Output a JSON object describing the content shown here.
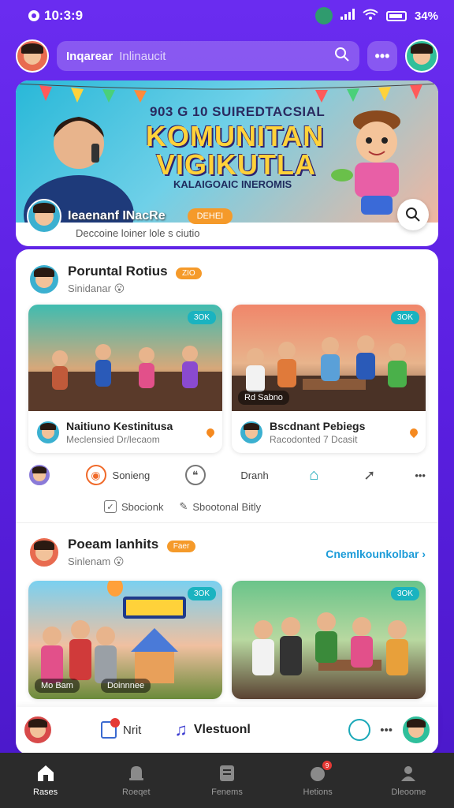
{
  "status": {
    "time": "10:3:9",
    "battery": "34%"
  },
  "top": {
    "search_label": "Inqarear",
    "search_placeholder": "Inlinaucit",
    "more": "•••"
  },
  "hero": {
    "line1": "903 G 10 SUIREDTACSIAL",
    "line2": "KOMUNITAN",
    "line3": "VIGIKUTLA",
    "subtitle": "KALAIGOAIC INEROMIS",
    "name": "Ieaenanf INacRe",
    "tag": "DEHEI",
    "caption": "Deccoine loiner lole s ciutio"
  },
  "post1": {
    "title": "Poruntal Rotius",
    "badge": "ZIO",
    "sub": "Sinidanar",
    "tiles": [
      {
        "tag": "3OK",
        "label": "",
        "name": "Naitiuno Kestinitusa",
        "meta": "Meclensied Dr/lecaom"
      },
      {
        "tag": "3OK",
        "label": "Rd  Sabno",
        "name": "Bscdnant Pebiegs",
        "meta": "Racodonted 7 Dcasit"
      }
    ]
  },
  "actions": [
    {
      "icon": "avatar",
      "label": ""
    },
    {
      "icon": "chat-icon",
      "label": "Sonieng"
    },
    {
      "icon": "quote-icon",
      "label": "Dranh"
    },
    {
      "icon": "screen-icon",
      "label": ""
    },
    {
      "icon": "share-icon",
      "label": ""
    },
    {
      "icon": "more-icon",
      "label": "•••"
    }
  ],
  "subactions": [
    "Sbocionk",
    "Sbootonal Bitly"
  ],
  "post2": {
    "title": "Poeam lanhits",
    "badge": "Faer",
    "sub": "Sinlenam",
    "link": "Cnemlkounkolbar  ›",
    "tiles": [
      {
        "tag": "3OK",
        "label": "Mo Bam",
        "sub_label": "Doinnnee"
      },
      {
        "tag": "3OK",
        "label": ""
      }
    ]
  },
  "mini_bar": {
    "item1": "Nrit",
    "item2": "Vlestuonl",
    "more": "•••"
  },
  "nav": [
    {
      "label": "Rases",
      "icon": "home-icon",
      "active": true
    },
    {
      "label": "Roeqet",
      "icon": "bell-icon",
      "active": false
    },
    {
      "label": "Fenems",
      "icon": "doc-icon",
      "active": false
    },
    {
      "label": "Hetions",
      "icon": "gift-icon",
      "active": false,
      "badge": "9"
    },
    {
      "label": "Dleoome",
      "icon": "profile-icon",
      "active": false
    }
  ]
}
